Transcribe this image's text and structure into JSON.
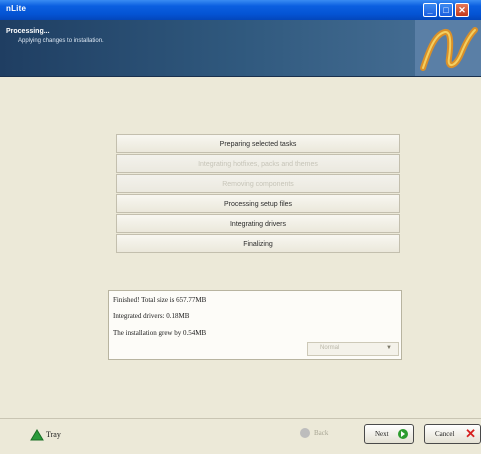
{
  "window": {
    "title": "nLite",
    "header_title": "Processing...",
    "header_subtitle": "Applying changes to installation."
  },
  "tasks": [
    {
      "label": "Preparing selected tasks",
      "state": "done"
    },
    {
      "label": "Integrating hotfixes, packs and themes",
      "state": "skipped"
    },
    {
      "label": "Removing components",
      "state": "skipped"
    },
    {
      "label": "Processing setup files",
      "state": "done"
    },
    {
      "label": "Integrating drivers",
      "state": "done"
    },
    {
      "label": "Finalizing",
      "state": "done"
    }
  ],
  "log": {
    "lines": [
      "Finished! Total size is 657.77MB",
      "Integrated drivers: 0.18MB",
      "The installation grew by 0.54MB"
    ],
    "dropdown_value": "Normal"
  },
  "footer": {
    "tray_label": "Tray",
    "back_label": "Back",
    "next_label": "Next",
    "cancel_label": "Cancel"
  },
  "colors": {
    "titlebar": "#0454d4",
    "header": "#30597e",
    "window_bg": "#ece9d8",
    "next_icon": "#2d9c2f",
    "cancel_icon": "#d62020"
  }
}
